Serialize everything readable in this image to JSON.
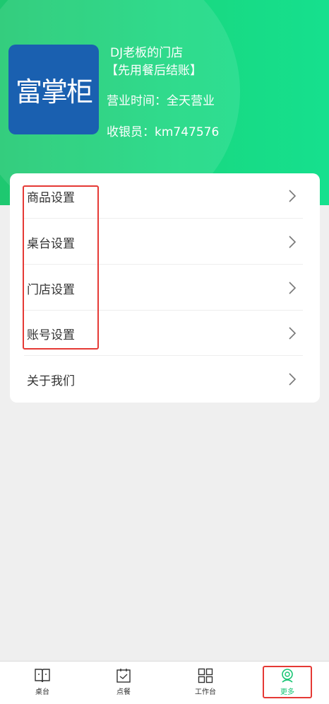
{
  "header": {
    "logo_text": "富掌柜",
    "store_name": "DJ老板的门店",
    "store_mode": "【先用餐后结账】",
    "business_hours": "营业时间：全天营业",
    "cashier": "收银员：km747576"
  },
  "menu": {
    "items": [
      {
        "label": "商品设置"
      },
      {
        "label": "桌台设置"
      },
      {
        "label": "门店设置"
      },
      {
        "label": "账号设置"
      },
      {
        "label": "关于我们"
      }
    ]
  },
  "tabbar": {
    "active_color": "#18c574",
    "items": [
      {
        "label": "桌台",
        "icon": "book-icon"
      },
      {
        "label": "点餐",
        "icon": "clipboard-check-icon"
      },
      {
        "label": "工作台",
        "icon": "grid-icon"
      },
      {
        "label": "更多",
        "icon": "user-icon"
      }
    ]
  }
}
